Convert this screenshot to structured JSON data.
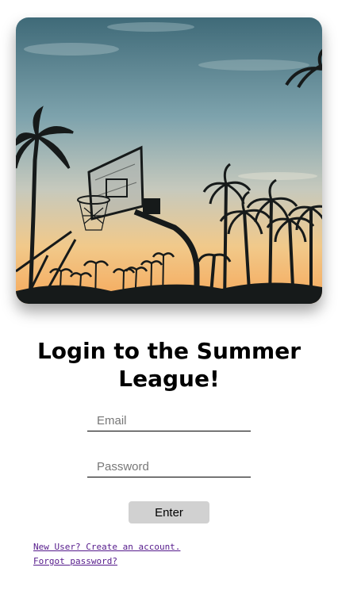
{
  "hero": {
    "image": "basketball-hoop-sunset-photo"
  },
  "login": {
    "title": "Login to the Summer League!",
    "email_placeholder": "Email",
    "password_placeholder": "Password",
    "enter_label": "Enter"
  },
  "links": {
    "new_user": "New User? Create an account.",
    "forgot_password": "Forgot password?"
  },
  "colors": {
    "button_bg": "#d1d1d1",
    "link": "#551a8b"
  }
}
